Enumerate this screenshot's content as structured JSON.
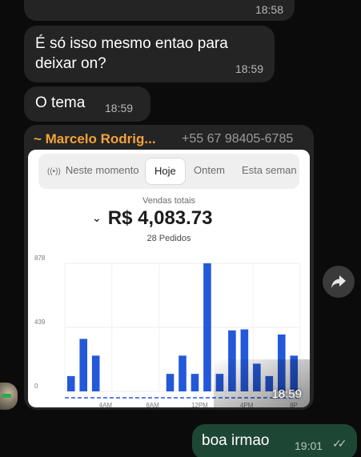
{
  "messages": {
    "top_time": "18:58",
    "msg1": {
      "text": "É só isso mesmo entao para deixar on?",
      "time": "18:59"
    },
    "msg2": {
      "text": "O tema",
      "time": "18:59"
    },
    "image_msg": {
      "sender": "~ Marcelo Rodrig...",
      "phone": "+55 67 98405-6785",
      "time": "18:59"
    },
    "outgoing": {
      "text": "boa irmao",
      "time": "19:01",
      "status_icon": "double-check-icon"
    }
  },
  "screenshot": {
    "tabs": {
      "live": "Neste momento",
      "today": "Hoje",
      "yesterday": "Ontem",
      "week": "Esta seman"
    },
    "summary": {
      "label": "Vendas totais",
      "value": "R$ 4,083.73",
      "orders": "28 Pedidos"
    }
  },
  "chart_data": {
    "type": "bar",
    "bar_color": "#2358d8",
    "y_ticks": [
      "878",
      "439",
      "0"
    ],
    "ylim": [
      0,
      878
    ],
    "x_tick_labels": [
      "4AM",
      "8AM",
      "12PM",
      "4PM",
      "8P"
    ],
    "values": [
      105,
      360,
      245,
      0,
      0,
      0,
      0,
      0,
      120,
      245,
      120,
      878,
      120,
      418,
      425,
      190,
      105,
      390,
      245
    ]
  },
  "icons": {
    "forward": "forward-icon",
    "avatar": "avatar"
  }
}
